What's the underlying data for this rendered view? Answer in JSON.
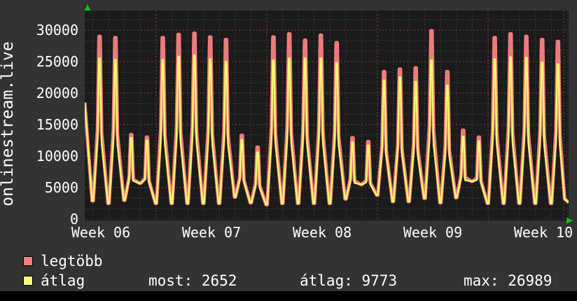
{
  "title": "onlinestream.live",
  "legend": [
    {
      "label": "legtöbb",
      "color": "#f08080"
    },
    {
      "label": "átlag",
      "color": "#f9f97f"
    }
  ],
  "stats": [
    {
      "label": "most:",
      "value": "2652"
    },
    {
      "label": "átlag:",
      "value": "9773"
    },
    {
      "label": "max:",
      "value": "26989"
    }
  ],
  "chart_data": {
    "type": "line",
    "title": "onlinestream.live",
    "x_tick_labels": [
      "Week 06",
      "Week 07",
      "Week 08",
      "Week 09",
      "Week 10"
    ],
    "y_ticks": [
      0,
      5000,
      10000,
      15000,
      20000,
      25000,
      30000
    ],
    "ylim": [
      0,
      33000
    ],
    "grid": {
      "minor_color": "#4f4f4f",
      "major_color": "#8e3d3a",
      "plot_bg": "#1b1b1b",
      "outer_bg": "#333333",
      "arrow_color": "#00cc00"
    },
    "legend_position": "bottom-left",
    "days_shown": 30,
    "series": [
      {
        "name": "legtöbb",
        "color": "#ee7b7b",
        "daily_peaks": [
          29000,
          28800,
          13400,
          13000,
          28800,
          29300,
          29500,
          28900,
          28500,
          13300,
          11400,
          28900,
          29400,
          28400,
          29200,
          28000,
          12900,
          12300,
          23400,
          23800,
          24000,
          29900,
          23400,
          14100,
          13000,
          28800,
          29400,
          29000,
          28500,
          28200
        ]
      },
      {
        "name": "átlag",
        "color": "#f7f76d",
        "daily_peaks": [
          25500,
          25300,
          12900,
          12500,
          25300,
          25800,
          26000,
          25400,
          25000,
          12600,
          10600,
          25200,
          25500,
          25500,
          25500,
          24800,
          12200,
          11700,
          22000,
          22500,
          21800,
          25200,
          21200,
          13100,
          12400,
          25400,
          25700,
          25600,
          24900,
          24600
        ]
      }
    ],
    "daily_troughs": [
      2900,
      2500,
      3000,
      5700,
      2500,
      2500,
      2500,
      2500,
      2500,
      3500,
      2600,
      2300,
      2500,
      2500,
      2500,
      2500,
      3200,
      5500,
      3800,
      2800,
      2800,
      3300,
      2600,
      3400,
      6000,
      2500,
      2500,
      2500,
      2500,
      2500
    ],
    "start_value": 18500,
    "end_value": 2652,
    "summary": {
      "current": 2652,
      "average": 9773,
      "max": 26989
    }
  }
}
